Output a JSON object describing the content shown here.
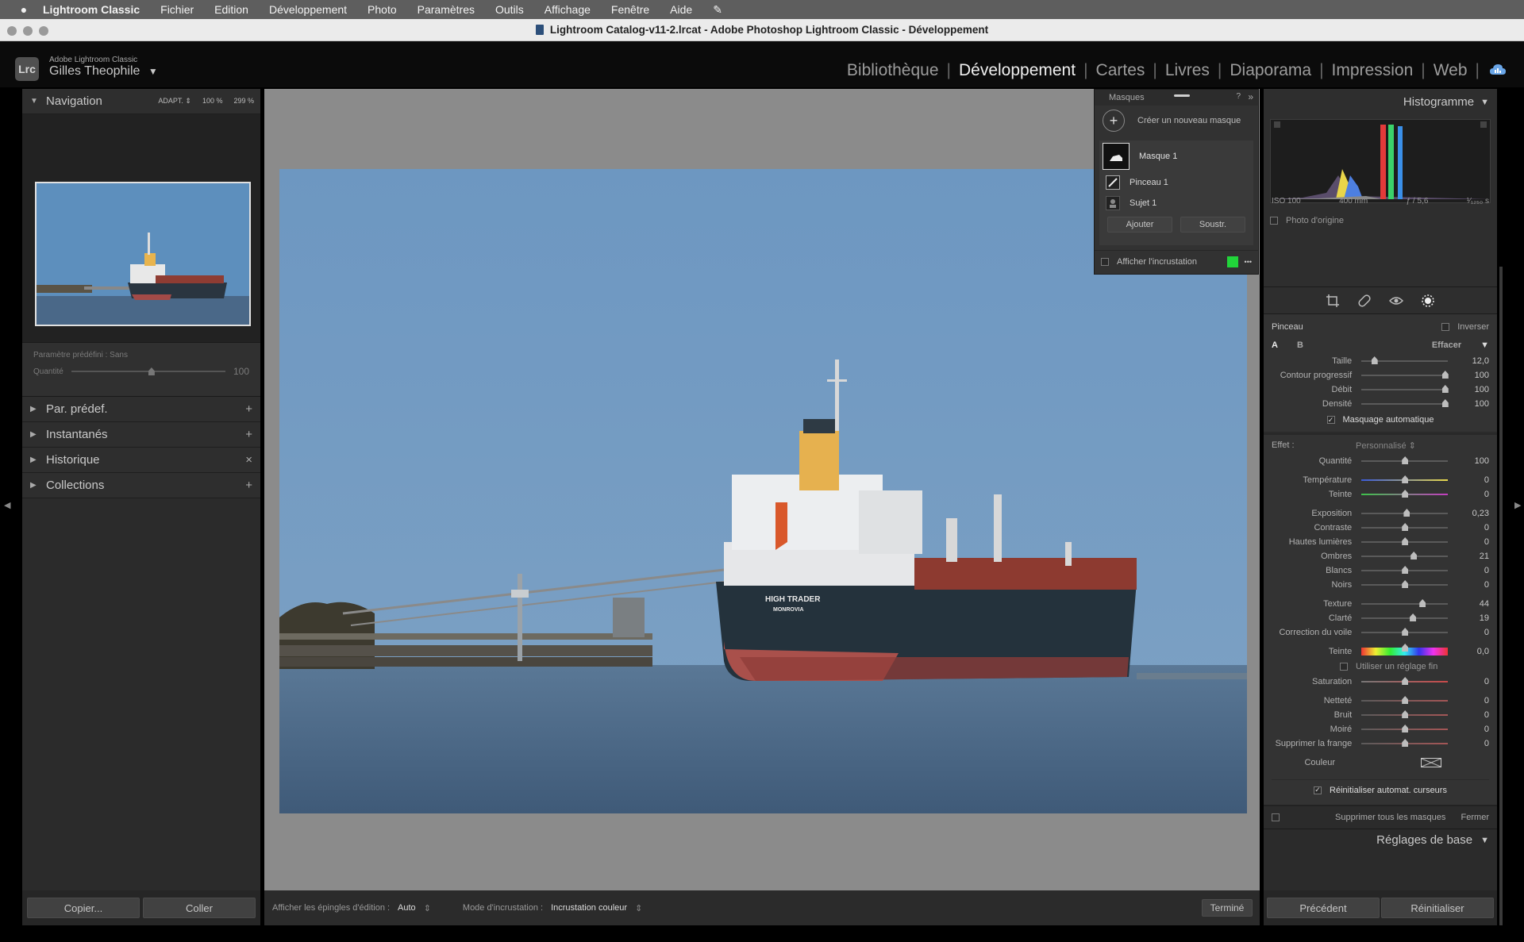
{
  "menubar": {
    "app": "Lightroom Classic",
    "items": [
      "Fichier",
      "Edition",
      "Développement",
      "Photo",
      "Paramètres",
      "Outils",
      "Affichage",
      "Fenêtre",
      "Aide"
    ]
  },
  "window": {
    "title": "Lightroom Catalog-v11-2.lrcat - Adobe Photoshop Lightroom Classic - Développement"
  },
  "identity": {
    "badge": "Lrc",
    "brand": "Adobe Lightroom Classic",
    "user": "Gilles Theophile",
    "user_caret": "▼"
  },
  "modules": [
    "Bibliothèque",
    "Développement",
    "Cartes",
    "Livres",
    "Diaporama",
    "Impression",
    "Web"
  ],
  "active_module": "Développement",
  "left": {
    "navigator": {
      "title": "Navigation",
      "zoom": [
        "ADAPT. ⇕",
        "100 %",
        "299 %"
      ]
    },
    "preset": {
      "label": "Paramètre prédéfini : Sans",
      "qty_label": "Quantité",
      "qty_value": "100",
      "qty_level": 0.5
    },
    "sections": [
      {
        "label": "Par. prédef.",
        "action": "+"
      },
      {
        "label": "Instantanés",
        "action": "+"
      },
      {
        "label": "Historique",
        "action": "×"
      },
      {
        "label": "Collections",
        "action": "+"
      }
    ],
    "copy": "Copier...",
    "paste": "Coller"
  },
  "toolbar": {
    "pins_label": "Afficher les épingles d'édition :",
    "pins_value": "Auto",
    "overlay_label": "Mode d'incrustation :",
    "overlay_value": "Incrustation couleur",
    "done": "Terminé"
  },
  "photo": {
    "name_line1": "HIGH TRADER",
    "name_line2": "MONROVIA"
  },
  "masks": {
    "title": "Masques",
    "help": "?",
    "expand": "»",
    "create": "Créer un nouveau masque",
    "mask1": "Masque 1",
    "brush": "Pinceau 1",
    "subject": "Sujet 1",
    "add": "Ajouter",
    "subtract": "Soustr.",
    "overlay": "Afficher l'incrustation",
    "overlay_color": "#21d43a",
    "more": "•••"
  },
  "histogram": {
    "title": "Histogramme",
    "iso": "ISO 100",
    "focal": "400 mm",
    "aperture": "ƒ / 5,6",
    "shutter": "¹⁄₁₂₅₀ s",
    "original": "Photo d'origine"
  },
  "brush": {
    "title": "Pinceau",
    "invert": "Inverser",
    "a": "A",
    "b": "B",
    "erase": "Effacer",
    "sliders": [
      {
        "label": "Taille",
        "value": "12,0",
        "level": 0.15
      },
      {
        "label": "Contour progressif",
        "value": "100",
        "level": 0.96
      },
      {
        "label": "Débit",
        "value": "100",
        "level": 0.96
      },
      {
        "label": "Densité",
        "value": "100",
        "level": 0.96
      }
    ],
    "auto_mask": "Masquage automatique"
  },
  "effect": {
    "label": "Effet :",
    "preset": "Personnalisé ⇕",
    "amount": {
      "label": "Quantité",
      "value": "100",
      "level": 0.5
    },
    "temp": {
      "label": "Température",
      "value": "0",
      "level": 0.5
    },
    "tint": {
      "label": "Teinte",
      "value": "0",
      "level": 0.5
    },
    "tone": [
      {
        "label": "Exposition",
        "value": "0,23",
        "level": 0.52
      },
      {
        "label": "Contraste",
        "value": "0",
        "level": 0.5
      },
      {
        "label": "Hautes lumières",
        "value": "0",
        "level": 0.5
      },
      {
        "label": "Ombres",
        "value": "21",
        "level": 0.6
      },
      {
        "label": "Blancs",
        "value": "0",
        "level": 0.5
      },
      {
        "label": "Noirs",
        "value": "0",
        "level": 0.5
      }
    ],
    "presence": [
      {
        "label": "Texture",
        "value": "44",
        "level": 0.7
      },
      {
        "label": "Clarté",
        "value": "19",
        "level": 0.59
      },
      {
        "label": "Correction du voile",
        "value": "0",
        "level": 0.5
      }
    ],
    "hue": {
      "label": "Teinte",
      "value": "0,0",
      "level": 0.5
    },
    "fine": "Utiliser un réglage fin",
    "saturation": {
      "label": "Saturation",
      "value": "0",
      "level": 0.5
    },
    "detail": [
      {
        "label": "Netteté",
        "value": "0",
        "level": 0.5
      },
      {
        "label": "Bruit",
        "value": "0",
        "level": 0.5
      },
      {
        "label": "Moiré",
        "value": "0",
        "level": 0.5
      },
      {
        "label": "Supprimer la frange",
        "value": "0",
        "level": 0.5
      }
    ],
    "color_label": "Couleur",
    "reset_sliders": "Réinitialiser automat. curseurs"
  },
  "footer": {
    "delete_all": "Supprimer tous les masques",
    "close": "Fermer",
    "basic": "Réglages de base",
    "previous": "Précédent",
    "reset": "Réinitialiser"
  }
}
